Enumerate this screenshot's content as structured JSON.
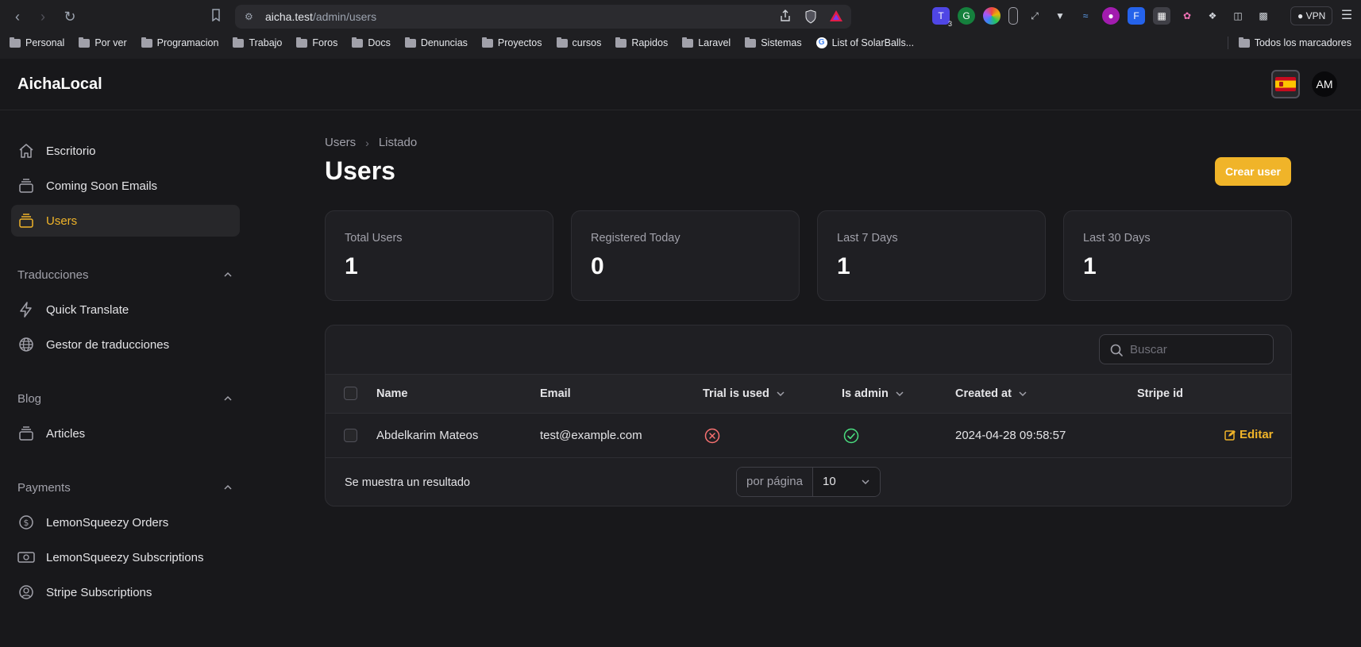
{
  "browser": {
    "url_host": "aicha.test",
    "url_path": "/admin/users",
    "vpn_label": "VPN",
    "bookmarks": [
      "Personal",
      "Por ver",
      "Programacion",
      "Trabajo",
      "Foros",
      "Docs",
      "Denuncias",
      "Proyectos",
      "cursos",
      "Rapidos",
      "Laravel",
      "Sistemas"
    ],
    "bookmark_link": "List of SolarBalls...",
    "all_bookmarks": "Todos los marcadores",
    "ext_badge": "3"
  },
  "app": {
    "brand": "AichaLocal",
    "avatar_initials": "AM",
    "locale_flag": "spain-flag-icon"
  },
  "sidebar": {
    "items": [
      {
        "label": "Escritorio",
        "icon": "home-icon"
      },
      {
        "label": "Coming Soon Emails",
        "icon": "stack-icon"
      },
      {
        "label": "Users",
        "icon": "stack-icon",
        "active": true
      }
    ],
    "groups": [
      {
        "title": "Traducciones",
        "items": [
          {
            "label": "Quick Translate",
            "icon": "bolt-icon"
          },
          {
            "label": "Gestor de traducciones",
            "icon": "globe-icon"
          }
        ]
      },
      {
        "title": "Blog",
        "items": [
          {
            "label": "Articles",
            "icon": "stack-icon"
          }
        ]
      },
      {
        "title": "Payments",
        "items": [
          {
            "label": "LemonSqueezy Orders",
            "icon": "dollar-circle-icon"
          },
          {
            "label": "LemonSqueezy Subscriptions",
            "icon": "banknote-icon"
          },
          {
            "label": "Stripe Subscriptions",
            "icon": "user-circle-icon"
          }
        ]
      }
    ]
  },
  "main": {
    "breadcrumb": [
      "Users",
      "Listado"
    ],
    "title": "Users",
    "create_button": "Crear user",
    "stats": [
      {
        "label": "Total Users",
        "value": "1"
      },
      {
        "label": "Registered Today",
        "value": "0"
      },
      {
        "label": "Last 7 Days",
        "value": "1"
      },
      {
        "label": "Last 30 Days",
        "value": "1"
      }
    ],
    "table": {
      "search_placeholder": "Buscar",
      "columns": [
        "Name",
        "Email",
        "Trial is used",
        "Is admin",
        "Created at",
        "Stripe id"
      ],
      "rows": [
        {
          "name": "Abdelkarim Mateos",
          "email": "test@example.com",
          "trial_is_used": false,
          "is_admin": true,
          "created_at": "2024-04-28 09:58:57",
          "stripe_id": "",
          "action": "Editar"
        }
      ],
      "result_text": "Se muestra un resultado",
      "per_page_label": "por página",
      "per_page_value": "10"
    }
  },
  "colors": {
    "accent": "#f0b429",
    "danger": "#f87171",
    "success": "#4ade80",
    "background": "#18181b"
  }
}
